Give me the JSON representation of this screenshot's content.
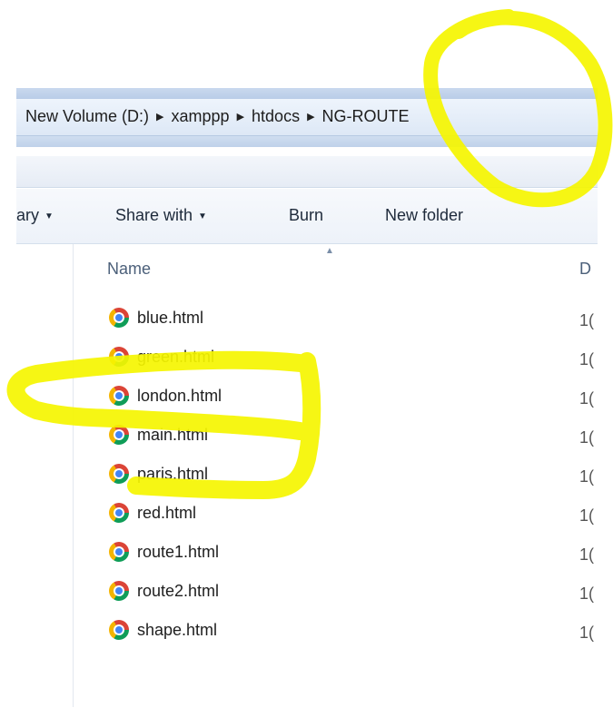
{
  "address_bar": {
    "crumbs": [
      "New Volume (D:)",
      "xamppp",
      "htdocs",
      "NG-ROUTE"
    ]
  },
  "toolbar": {
    "organize_label": "ary",
    "share_label": "Share with",
    "burn_label": "Burn",
    "new_folder_label": "New folder"
  },
  "columns": {
    "name": "Name",
    "date_partial": "D"
  },
  "files": [
    {
      "name": "blue.html",
      "date": "1("
    },
    {
      "name": "green.html",
      "date": "1("
    },
    {
      "name": "london.html",
      "date": "1("
    },
    {
      "name": "main.html",
      "date": "1("
    },
    {
      "name": "paris.html",
      "date": "1("
    },
    {
      "name": "red.html",
      "date": "1("
    },
    {
      "name": "route1.html",
      "date": "1("
    },
    {
      "name": "route2.html",
      "date": "1("
    },
    {
      "name": "shape.html",
      "date": "1("
    }
  ],
  "colors": {
    "highlight": "#f5f500",
    "address_bar": "#dde8f6",
    "accent_text": "#4c607a"
  },
  "icons": {
    "file_icon": "chrome-icon",
    "separator": "chevron-right-icon",
    "dropdown": "caret-down-icon",
    "sort": "sort-up-icon"
  }
}
